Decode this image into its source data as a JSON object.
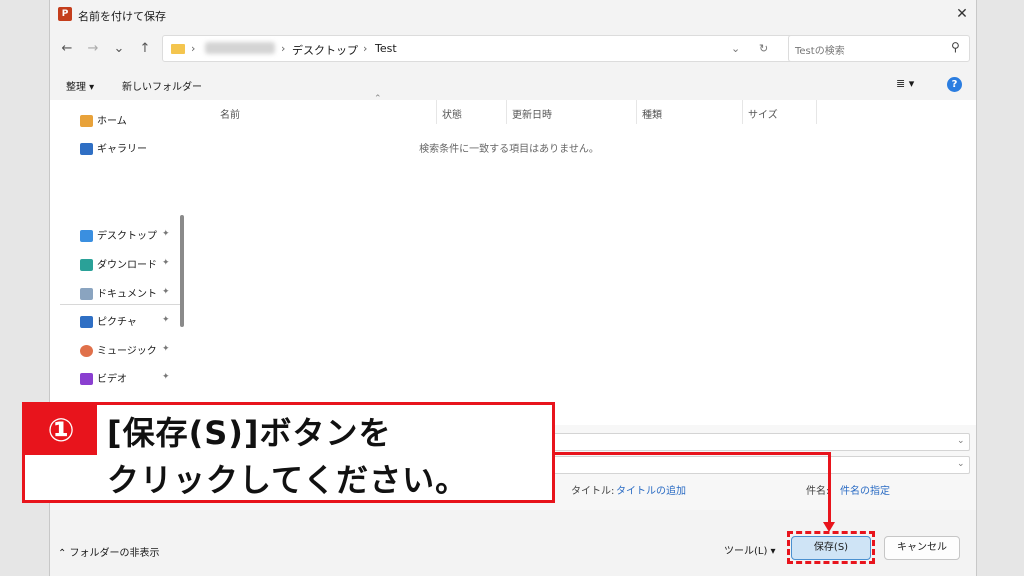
{
  "window": {
    "title": "名前を付けて保存",
    "close_symbol": "✕",
    "app_icon_letter": "P"
  },
  "nav": {
    "back": "←",
    "forward": "→",
    "recent": "⌄",
    "up": "↑",
    "breadcrumb": [
      "デスクトップ",
      "Test"
    ],
    "crumb_sep": "›",
    "refresh": "↻",
    "dropdown": "⌄",
    "search_placeholder": "Testの検索",
    "search_icon": "⚲"
  },
  "toolbar": {
    "organize": "整理 ▾",
    "new_folder": "新しいフォルダー",
    "view_icon": "≣ ▾",
    "help": "?"
  },
  "sidebar": {
    "top_items": [
      {
        "label": "ホーム",
        "icon": "home-icon",
        "color": "#e8a23a"
      },
      {
        "label": "ギャラリー",
        "icon": "gallery-icon",
        "color": "#2f6fc4"
      }
    ],
    "pinned_items": [
      {
        "label": "デスクトップ",
        "icon": "desktop-icon",
        "color": "#3a8fe0"
      },
      {
        "label": "ダウンロード",
        "icon": "download-icon",
        "color": "#2aa198"
      },
      {
        "label": "ドキュメント",
        "icon": "document-icon",
        "color": "#8aa4c0"
      },
      {
        "label": "ピクチャ",
        "icon": "pictures-icon",
        "color": "#2f6fc4"
      },
      {
        "label": "ミュージック",
        "icon": "music-icon",
        "color": "#e0704a"
      },
      {
        "label": "ビデオ",
        "icon": "video-icon",
        "color": "#8a3fd0"
      }
    ],
    "pin_symbol": "📌"
  },
  "content": {
    "columns": [
      "名前",
      "状態",
      "更新日時",
      "種類",
      "サイズ"
    ],
    "sort_indicator": "⌃",
    "empty_message": "検索条件に一致する項目はありません。"
  },
  "fields": {
    "title_label": "タイトル:",
    "title_value": "タイトルの追加",
    "subject_label": "件名:",
    "subject_value": "件名の指定",
    "dropdown": "⌄"
  },
  "footer": {
    "hide_folders": "⌃ フォルダーの非表示",
    "tools": "ツール(L)  ▾",
    "save": "保存(S)",
    "cancel": "キャンセル"
  },
  "annotation": {
    "number": "①",
    "line1": "[保存(S)]ボタンを",
    "line2": "クリックしてください。"
  },
  "colors": {
    "accent_red": "#e8141c",
    "save_button_bg": "#cfe4f6",
    "link_blue": "#2b6cc4"
  }
}
